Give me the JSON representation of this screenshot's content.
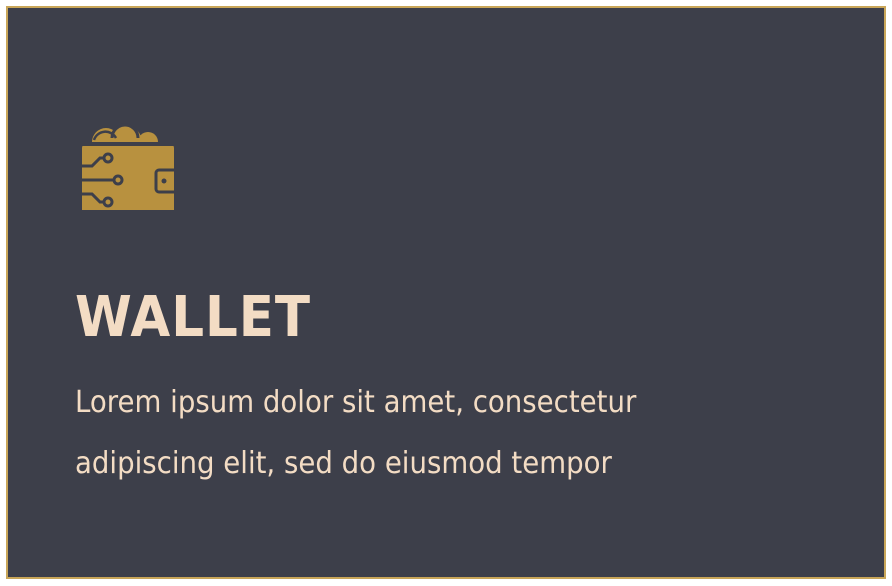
{
  "card": {
    "icon": "wallet-icon",
    "title": "WALLET",
    "description_lines": [
      "Lorem ipsum dolor sit amet, consectetur",
      "adipiscing elit, sed do eiusmod tempor"
    ]
  },
  "colors": {
    "background": "#3d3f4a",
    "border": "#c9a659",
    "accent": "#b8913f",
    "text": "#f3dcc4"
  }
}
